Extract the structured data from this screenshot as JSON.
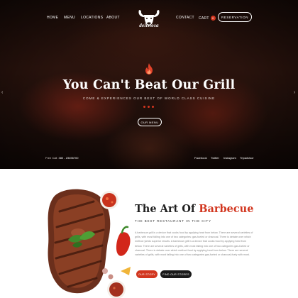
{
  "nav": {
    "home": "Home",
    "menu": "Menu",
    "locations": "Locations",
    "about": "About",
    "contact": "Contact",
    "cart": "Cart",
    "cart_count": "0",
    "reservation": "Reservation"
  },
  "logo": {
    "text": "delisiosa"
  },
  "hero": {
    "title": "You Can't Beat Our Grill",
    "subtitle": "Come & experiences our best of world class cuisine",
    "menu_button": "Our Menu",
    "free_call_label": "Free Call:",
    "free_call_number": "380 - 23456700",
    "social": [
      "Facebook",
      "Twitter",
      "Instagram",
      "Tripadvisor"
    ]
  },
  "about": {
    "title_prefix": "The Art Of",
    "title_accent": "Barbecue",
    "subtitle": "The best restaurant in the city",
    "body": "A barbecue grill is a device that cooks food by applying heat from below. There are several varieties of grills, with most falling into one of two categories: gas-fueled or charcoal. There is debate over which method yields superior results. A barbecue grill is a device that cooks food by applying heat from below. There are several varieties of grills, with most falling into one of two categories gas-fueled or charcoal. There is debate over which method food by applying heat from below. There are several varieties of grills, with most falling into one of two categories gas-fueled or charcoal-fuely with most.",
    "our_story_button": "Our Story",
    "find_stores_button": "Find Our Stores"
  },
  "colors": {
    "accent": "#d2361f",
    "dark": "#1a1a1a",
    "hero_bg": "#1f0f0a"
  },
  "icons": [
    "bull-logo-icon",
    "flame-icon",
    "arrow-left-icon",
    "arrow-right-icon"
  ]
}
